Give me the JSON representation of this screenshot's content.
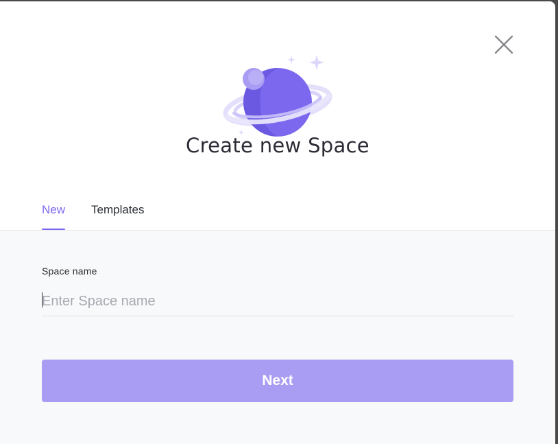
{
  "dialog": {
    "title": "Create new Space",
    "close_icon": "close-icon",
    "illustration": "planet-illustration"
  },
  "tabs": [
    {
      "label": "New",
      "active": true
    },
    {
      "label": "Templates",
      "active": false
    }
  ],
  "form": {
    "space_name_label": "Space name",
    "space_name_value": "",
    "space_name_placeholder": "Enter Space name",
    "next_label": "Next"
  },
  "colors": {
    "accent": "#7b68ee",
    "button_disabled": "#a99cf3",
    "form_background": "#f8f9fa",
    "title_text": "#2b2b35"
  }
}
